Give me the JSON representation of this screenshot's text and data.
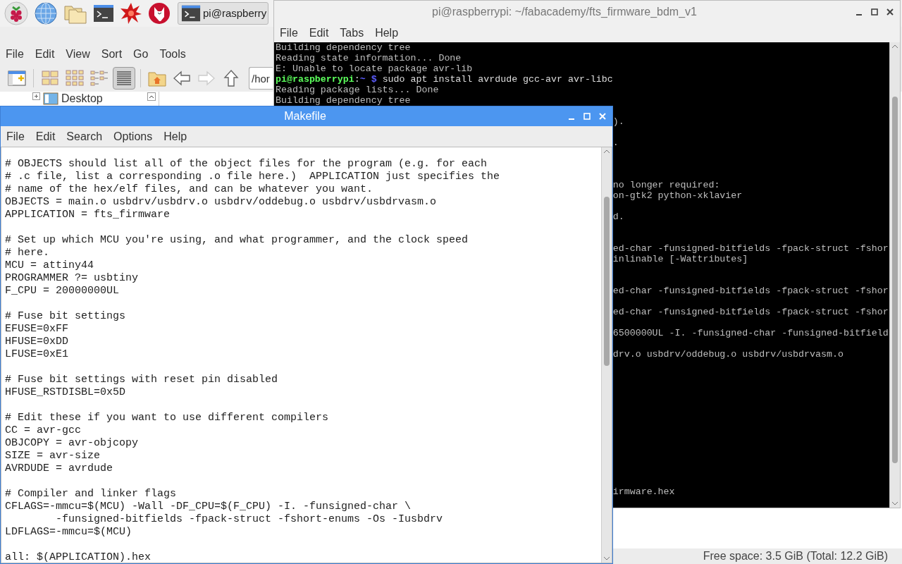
{
  "taskbar": {
    "task_buttons": [
      {
        "label": "pi@raspberry"
      }
    ]
  },
  "file_manager": {
    "menu": [
      "File",
      "Edit",
      "View",
      "Sort",
      "Go",
      "Tools"
    ],
    "view_buttons": [
      {
        "selected": false
      },
      {
        "selected": false
      },
      {
        "selected": false
      },
      {
        "selected": true
      }
    ],
    "path": "/hor",
    "tree": [
      {
        "label": "Desktop"
      }
    ],
    "status": "Free space: 3.5 GiB (Total: 12.2 GiB)"
  },
  "terminal": {
    "title": "pi@raspberrypi: ~/fabacademy/fts_firmware_bdm_v1",
    "menu": [
      "File",
      "Edit",
      "Tabs",
      "Help"
    ],
    "lines": [
      {
        "kind": "output",
        "text": "Building dependency tree"
      },
      {
        "kind": "output",
        "text": "Reading state information... Done"
      },
      {
        "kind": "output",
        "text": "E: Unable to locate package avr-lib"
      },
      {
        "kind": "prompt",
        "user": "pi@raspberrypi",
        "separator": ":",
        "path": "~",
        "symbol": "$",
        "command": "sudo apt install avrdude gcc-avr avr-libc"
      },
      {
        "kind": "output",
        "text": "Reading package lists... Done"
      },
      {
        "kind": "output",
        "text": "Building dependency tree"
      }
    ],
    "tail_lines": [
      ").",
      ".",
      "no longer required:",
      "on-gtk2 python-xklavier",
      "d.",
      "ed-char -funsigned-bitfields -fpack-struct -fshor",
      "inlinable [-Wattributes]",
      "ed-char -funsigned-bitfields -fpack-struct -fshor",
      "ed-char -funsigned-bitfields -fpack-struct -fshor",
      "6500000UL -I. -funsigned-char -funsigned-bitfield",
      "drv.o usbdrv/oddebug.o usbdrv/usbdrvasm.o",
      "irmware.hex"
    ]
  },
  "editor": {
    "title": "Makefile",
    "menu": [
      "File",
      "Edit",
      "Search",
      "Options",
      "Help"
    ],
    "text": "# OBJECTS should list all of the object files for the program (e.g. for each\n# .c file, list a corresponding .o file here.)  APPLICATION just specifies the\n# name of the hex/elf files, and can be whatever you want.\nOBJECTS = main.o usbdrv/usbdrv.o usbdrv/oddebug.o usbdrv/usbdrvasm.o\nAPPLICATION = fts_firmware\n\n# Set up which MCU you're using, and what programmer, and the clock speed\n# here.\nMCU = attiny44\nPROGRAMMER ?= usbtiny\nF_CPU = 20000000UL\n\n# Fuse bit settings\nEFUSE=0xFF\nHFUSE=0xDD\nLFUSE=0xE1\n\n# Fuse bit settings with reset pin disabled\nHFUSE_RSTDISBL=0x5D\n\n# Edit these if you want to use different compilers\nCC = avr-gcc\nOBJCOPY = avr-objcopy\nSIZE = avr-size\nAVRDUDE = avrdude\n\n# Compiler and linker flags\nCFLAGS=-mmcu=$(MCU) -Wall -DF_CPU=$(F_CPU) -I. -funsigned-char \\\n        -funsigned-bitfields -fpack-struct -fshort-enums -Os -Iusbdrv\nLDFLAGS=-mmcu=$(MCU)\n\nall: $(APPLICATION).hex"
  }
}
